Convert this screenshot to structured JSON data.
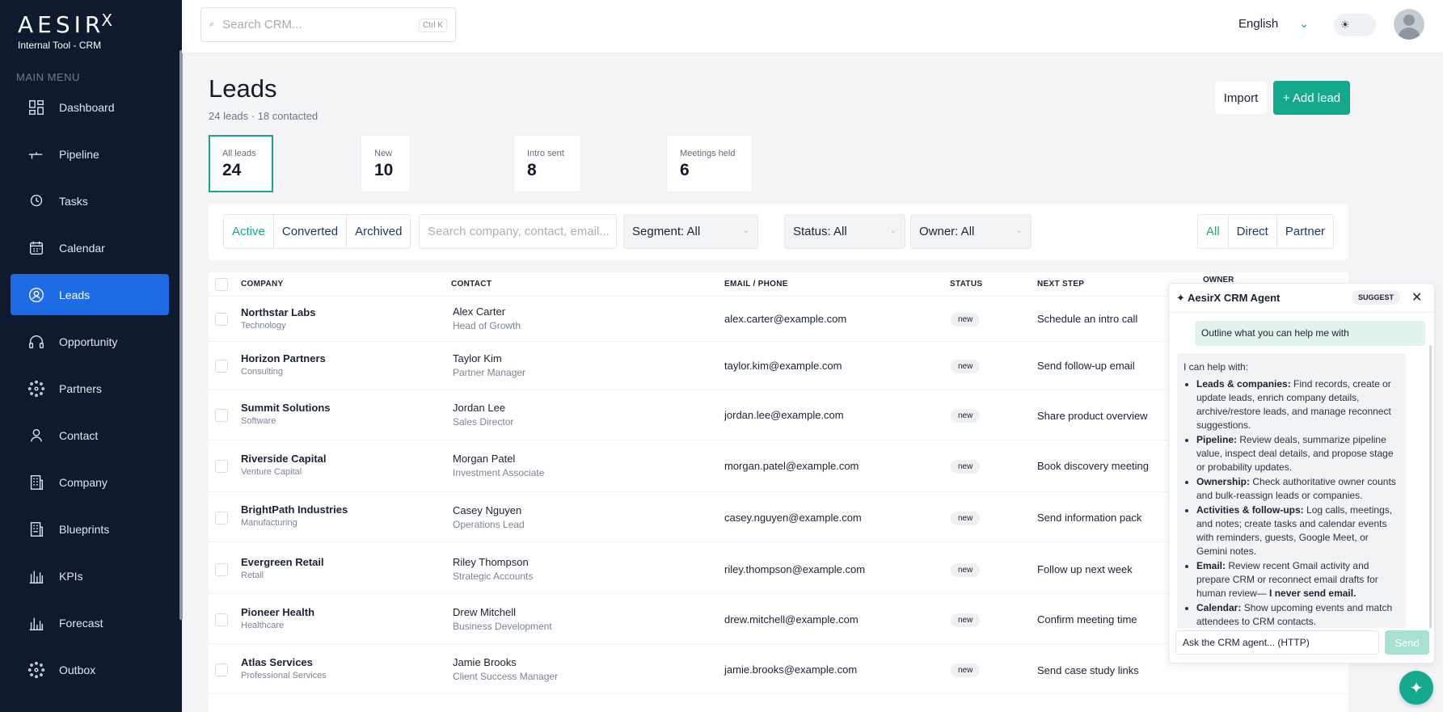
{
  "brand": {
    "logo": "AESIR",
    "logo_mark": "X",
    "subtitle": "Internal Tool - CRM"
  },
  "sidebar": {
    "section_label": "MAIN MENU",
    "items": [
      {
        "label": "Dashboard",
        "icon": "dashboard-icon"
      },
      {
        "label": "Pipeline",
        "icon": "pipeline-icon"
      },
      {
        "label": "Tasks",
        "icon": "clock-icon"
      },
      {
        "label": "Calendar",
        "icon": "calendar-icon"
      },
      {
        "label": "Leads",
        "icon": "leads-icon",
        "active": true
      },
      {
        "label": "Opportunity",
        "icon": "headset-icon"
      },
      {
        "label": "Partners",
        "icon": "network-icon"
      },
      {
        "label": "Contact",
        "icon": "person-icon"
      },
      {
        "label": "Company",
        "icon": "building-icon"
      },
      {
        "label": "Blueprints",
        "icon": "blueprint-icon"
      },
      {
        "label": "KPIs",
        "icon": "bar-chart-icon"
      },
      {
        "label": "Forecast",
        "icon": "forecast-icon"
      },
      {
        "label": "Outbox",
        "icon": "outbox-icon"
      }
    ]
  },
  "topbar": {
    "search_placeholder": "Search CRM...",
    "shortcut": "Ctrl K",
    "language": "English"
  },
  "page": {
    "title": "Leads",
    "subtitle": "24 leads · 18 contacted",
    "import_label": "Import",
    "add_label": "+ Add lead"
  },
  "stats": [
    {
      "label": "All leads",
      "value": "24"
    },
    {
      "label": "New",
      "value": "10"
    },
    {
      "label": "Intro sent",
      "value": "8"
    },
    {
      "label": "Meetings held",
      "value": "6"
    }
  ],
  "filters": {
    "tabs": [
      "Active",
      "Converted",
      "Archived"
    ],
    "search_placeholder": "Search company, contact, email...",
    "segment": "Segment: All",
    "status": "Status: All",
    "owner": "Owner: All",
    "type_tabs": [
      "All",
      "Direct",
      "Partner"
    ]
  },
  "table": {
    "headers": [
      "COMPANY",
      "CONTACT",
      "EMAIL / PHONE",
      "STATUS",
      "NEXT STEP",
      "OWNER"
    ],
    "rows": [
      {
        "company": "Northstar Labs",
        "industry": "Technology",
        "contact": "Alex Carter",
        "role": "Head of Growth",
        "email": "alex.carter@example.com",
        "status": "new",
        "next": "Schedule an intro call"
      },
      {
        "company": "Horizon Partners",
        "industry": "Consulting",
        "contact": "Taylor Kim",
        "role": "Partner Manager",
        "email": "taylor.kim@example.com",
        "status": "new",
        "next": "Send follow-up email"
      },
      {
        "company": "Summit Solutions",
        "industry": "Software",
        "contact": "Jordan Lee",
        "role": "Sales Director",
        "email": "jordan.lee@example.com",
        "status": "new",
        "next": "Share product overview"
      },
      {
        "company": "Riverside Capital",
        "industry": "Venture Capital",
        "contact": "Morgan Patel",
        "role": "Investment Associate",
        "email": "morgan.patel@example.com",
        "status": "new",
        "next": "Book discovery meeting"
      },
      {
        "company": "BrightPath Industries",
        "industry": "Manufacturing",
        "contact": "Casey Nguyen",
        "role": "Operations Lead",
        "email": "casey.nguyen@example.com",
        "status": "new",
        "next": "Send information pack"
      },
      {
        "company": "Evergreen Retail",
        "industry": "Retail",
        "contact": "Riley Thompson",
        "role": "Strategic Accounts",
        "email": "riley.thompson@example.com",
        "status": "new",
        "next": "Follow up next week"
      },
      {
        "company": "Pioneer Health",
        "industry": "Healthcare",
        "contact": "Drew Mitchell",
        "role": "Business Development",
        "email": "drew.mitchell@example.com",
        "status": "new",
        "next": "Confirm meeting time"
      },
      {
        "company": "Atlas Services",
        "industry": "Professional Services",
        "contact": "Jamie Brooks",
        "role": "Client Success Manager",
        "email": "jamie.brooks@example.com",
        "status": "new",
        "next": "Send case study links"
      }
    ]
  },
  "agent": {
    "title": "✦ AesirX CRM Agent",
    "badge": "SUGGEST",
    "close": "✕",
    "user_message": "Outline what you can help me with",
    "intro": "I can help with:",
    "items": [
      {
        "title": "Leads & companies:",
        "text": " Find records, create or update leads, enrich company details, archive/restore leads, and manage reconnect suggestions."
      },
      {
        "title": "Pipeline:",
        "text": " Review deals, summarize pipeline value, inspect deal details, and propose stage or probability updates."
      },
      {
        "title": "Ownership:",
        "text": " Check authoritative owner counts and bulk-reassign leads or companies."
      },
      {
        "title": "Activities & follow-ups:",
        "text": " Log calls, meetings, and notes; create tasks and calendar events with reminders, guests, Google Meet, or Gemini notes."
      },
      {
        "title": "Email:",
        "text": " Review recent Gmail activity and prepare CRM or reconnect email drafts for human review— ",
        "bold_tail": "I never send email."
      },
      {
        "title": "Calendar:",
        "text": " Show upcoming events and match attendees to CRM contacts."
      }
    ],
    "input_placeholder": "Ask the CRM agent... (HTTP)",
    "send_label": "Send"
  },
  "colors": {
    "accent": "#14a88c",
    "sidebar_bg": "#0f1a2e",
    "active_nav": "#1e6be6"
  }
}
